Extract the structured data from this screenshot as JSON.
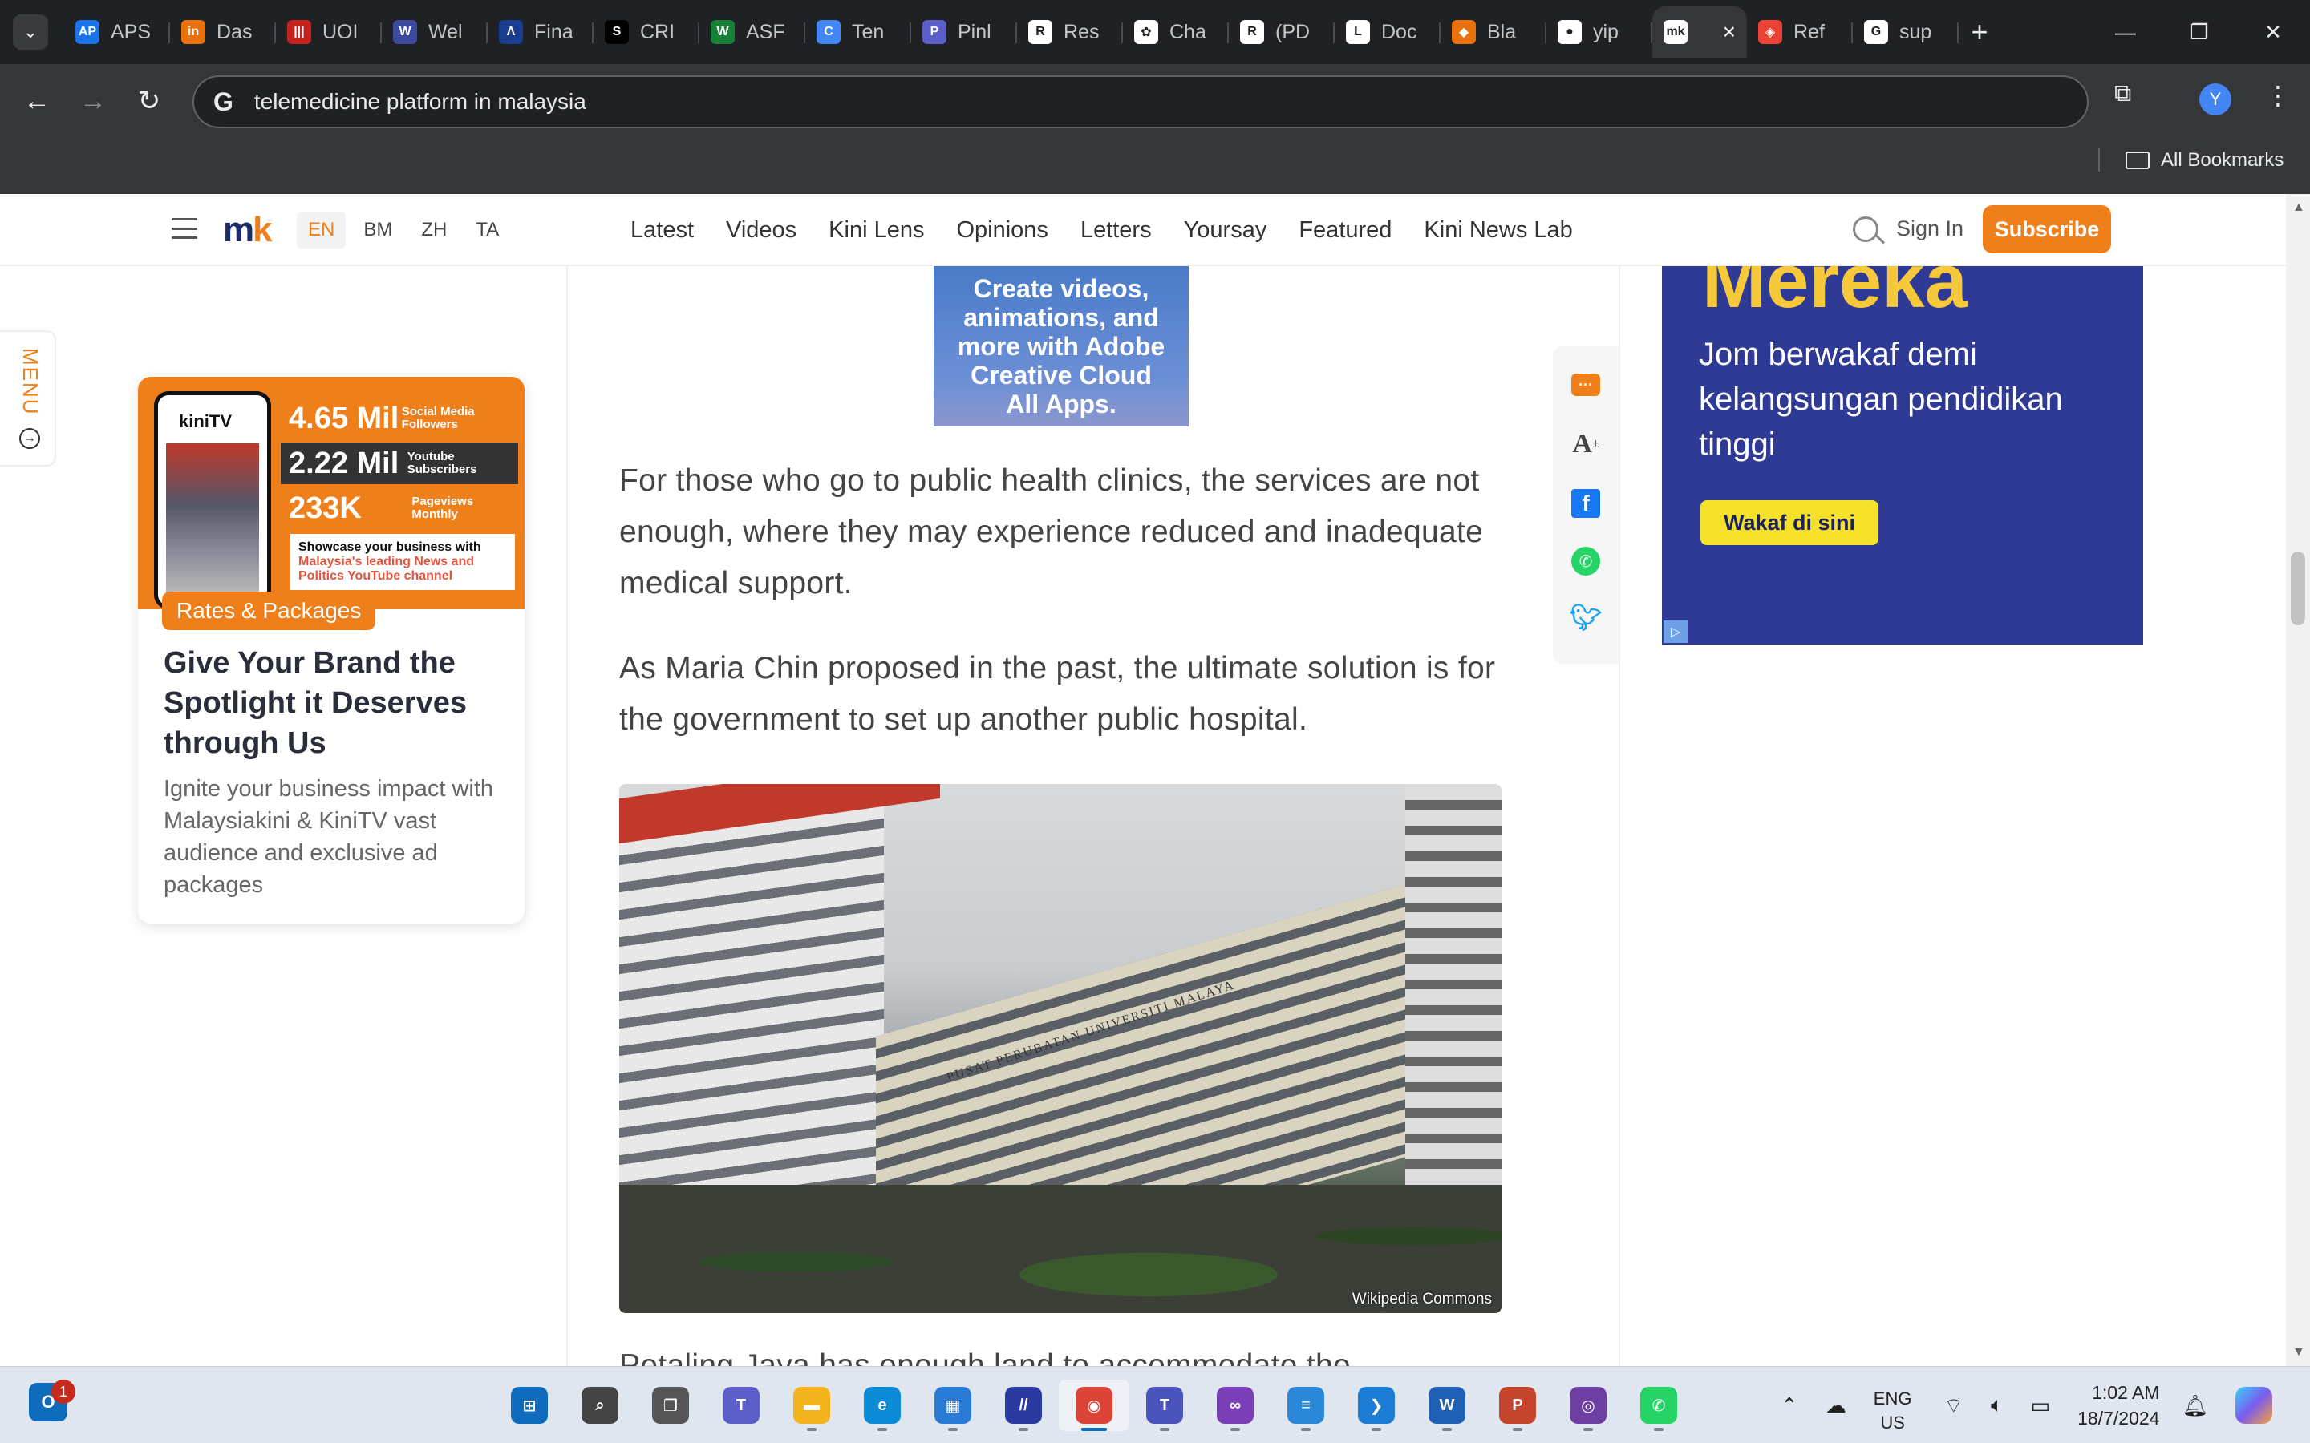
{
  "browser": {
    "tabs": [
      {
        "label": "APS",
        "icon": "aps-icon",
        "color": "#1a73e8",
        "glyph": "AP"
      },
      {
        "label": "Das",
        "icon": "dashboard-icon",
        "color": "#e8710a",
        "glyph": "in"
      },
      {
        "label": "UOI",
        "icon": "uo-icon",
        "color": "#c5221f",
        "glyph": "|||"
      },
      {
        "label": "Wel",
        "icon": "welcome-icon",
        "color": "#3c4a9e",
        "glyph": "W"
      },
      {
        "label": "Fina",
        "icon": "finance-icon",
        "color": "#1a3d8f",
        "glyph": "Λ"
      },
      {
        "label": "CRI",
        "icon": "cri-icon",
        "color": "#000000",
        "glyph": "S"
      },
      {
        "label": "ASF",
        "icon": "asf-icon",
        "color": "#188038",
        "glyph": "W"
      },
      {
        "label": "Ten",
        "icon": "template-icon",
        "color": "#4285f4",
        "glyph": "C"
      },
      {
        "label": "Pinl",
        "icon": "pinterest-icon",
        "color": "#5b5fc7",
        "glyph": "P"
      },
      {
        "label": "Res",
        "icon": "researchgate-icon",
        "color": "#ffffff",
        "glyph": "R"
      },
      {
        "label": "Cha",
        "icon": "chatgpt-icon",
        "color": "#ffffff",
        "glyph": "✿"
      },
      {
        "label": "(PD",
        "icon": "researchgate-pdf-icon",
        "color": "#ffffff",
        "glyph": "R"
      },
      {
        "label": "Doc",
        "icon": "doc-icon",
        "color": "#ffffff",
        "glyph": "L"
      },
      {
        "label": "Bla",
        "icon": "blackboard-icon",
        "color": "#e8710a",
        "glyph": "◆"
      },
      {
        "label": "yip",
        "icon": "github-icon",
        "color": "#ffffff",
        "glyph": "●"
      },
      {
        "label": "",
        "icon": "malaysiakini-icon",
        "color": "#ffffff",
        "glyph": "mk",
        "active": true
      },
      {
        "label": "Ref",
        "icon": "reference-icon",
        "color": "#ea4335",
        "glyph": "◈"
      },
      {
        "label": "sup",
        "icon": "google-icon",
        "color": "#ffffff",
        "glyph": "G"
      }
    ],
    "address": "telemedicine platform in malaysia",
    "all_bookmarks": "All Bookmarks",
    "profile_initial": "Y"
  },
  "site": {
    "langs": [
      "EN",
      "BM",
      "ZH",
      "TA"
    ],
    "active_lang": "EN",
    "nav": [
      "Latest",
      "Videos",
      "Kini Lens",
      "Opinions",
      "Letters",
      "Yoursay",
      "Featured",
      "Kini News Lab"
    ],
    "sign_in": "Sign In",
    "subscribe": "Subscribe",
    "menu_label": "MENU",
    "accent": "#ef7f1a"
  },
  "promo": {
    "phone_brand": "kiniTV",
    "stats": [
      {
        "number": "4.65 Mil",
        "label": "Social Media Followers"
      },
      {
        "number": "2.22 Mil",
        "label": "Youtube Subscribers"
      },
      {
        "number": "233K",
        "label": "Pageviews Monthly"
      }
    ],
    "showcase_text": "Showcase your business with",
    "showcase_highlight": "Malaysia's leading News and Politics YouTube channel",
    "badge": "Rates & Packages",
    "title": "Give Your Brand the Spotlight it Deserves through Us",
    "description": "Ignite your business impact with Malaysiakini & KiniTV vast audience and exclusive ad packages"
  },
  "article": {
    "ad_text": "Create videos, animations, and more with Adobe Creative Cloud All Apps.",
    "paragraphs": [
      "For those who go to public health clinics, the services are not enough, where they may experience reduced and inadequate medical support.",
      "As Maria Chin proposed in the past, the ultimate solution is for the government to set up another public hospital.",
      "Petaling Jaya has enough land to accommodate the"
    ],
    "photo_sign": "PUSAT PERUBATAN UNIVERSITI MALAYA",
    "photo_credit": "Wikipedia Commons"
  },
  "right_ad": {
    "headline": "Mereka",
    "subtitle": "Jom berwakaf demi kelangsungan pendidikan tinggi",
    "button": "Wakaf di sini"
  },
  "taskbar": {
    "outlook_badge": "1",
    "apps": [
      {
        "name": "windows-start",
        "color": "#0f6cbd",
        "glyph": "⊞"
      },
      {
        "name": "search",
        "color": "#444444",
        "glyph": "⌕"
      },
      {
        "name": "task-view",
        "color": "#555555",
        "glyph": "❐"
      },
      {
        "name": "teams",
        "color": "#5b5fc7",
        "glyph": "T"
      },
      {
        "name": "file-explorer",
        "color": "#f2b31d",
        "glyph": "▬"
      },
      {
        "name": "edge",
        "color": "#0c8bd6",
        "glyph": "e"
      },
      {
        "name": "microsoft-store",
        "color": "#2a7bd6",
        "glyph": "▦"
      },
      {
        "name": "sketch-app",
        "color": "#2a3a9e",
        "glyph": "//"
      },
      {
        "name": "chrome",
        "color": "#db4437",
        "glyph": "◉",
        "active": true
      },
      {
        "name": "teams-new",
        "color": "#4b53bc",
        "glyph": "T"
      },
      {
        "name": "visual-studio",
        "color": "#7a3fb6",
        "glyph": "∞"
      },
      {
        "name": "notepad",
        "color": "#2b88d8",
        "glyph": "≡"
      },
      {
        "name": "vscode",
        "color": "#1c7cd6",
        "glyph": "❯"
      },
      {
        "name": "word",
        "color": "#1f5fb4",
        "glyph": "W"
      },
      {
        "name": "powerpoint",
        "color": "#c4452b",
        "glyph": "P"
      },
      {
        "name": "github-desktop",
        "color": "#6e3fa3",
        "glyph": "◎"
      },
      {
        "name": "whatsapp",
        "color": "#25d366",
        "glyph": "✆"
      }
    ],
    "lang_line1": "ENG",
    "lang_line2": "US",
    "time": "1:02 AM",
    "date": "18/7/2024"
  }
}
